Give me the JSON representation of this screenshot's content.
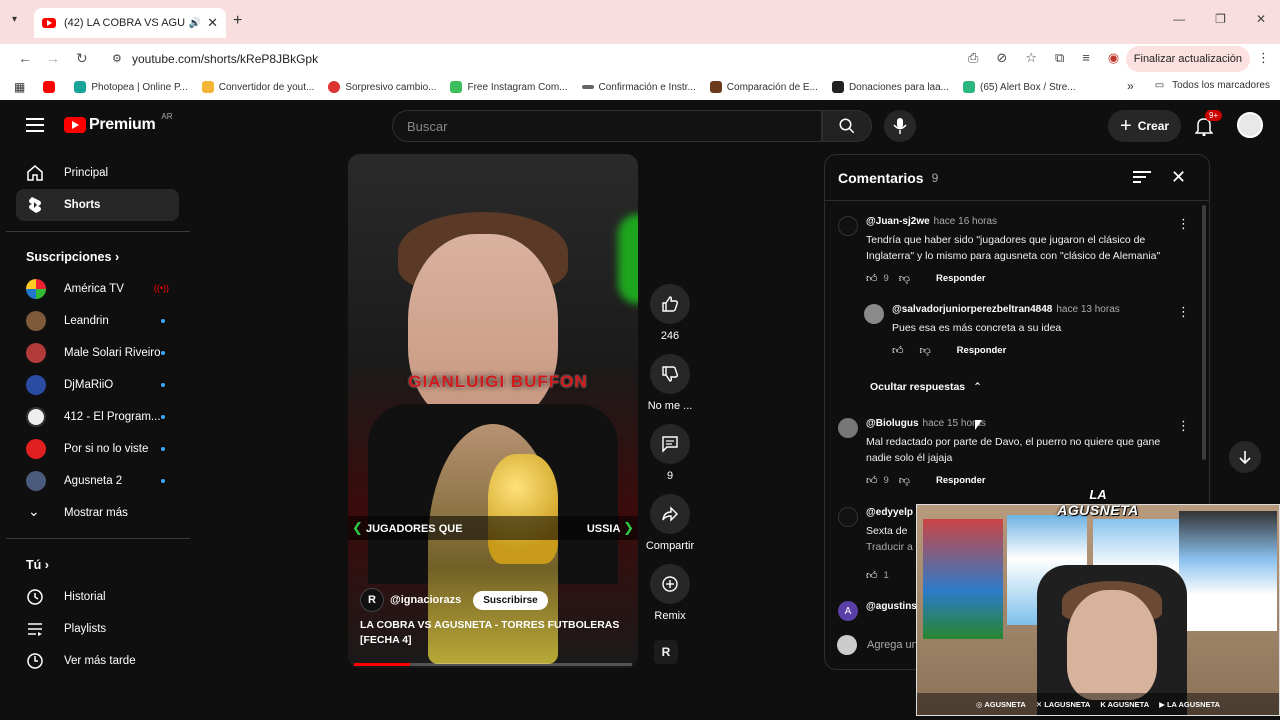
{
  "browser": {
    "tab_title": "(42) LA COBRA VS AGUSNE",
    "url": "youtube.com/shorts/kReP8JBkGpk",
    "update_label": "Finalizar actualización",
    "bookmarks": [
      {
        "label": "Photopea | Online P...",
        "color": "#18a497"
      },
      {
        "label": "Convertidor de yout...",
        "color": "#f2b534"
      },
      {
        "label": "Sorpresivo cambio...",
        "color": "#d33"
      },
      {
        "label": "Free Instagram Com...",
        "color": "#3cbf5a"
      },
      {
        "label": "Confirmación e Instr...",
        "color": "#666"
      },
      {
        "label": "Comparación de E...",
        "color": "#6b3a1a"
      },
      {
        "label": "Donaciones para laa...",
        "color": "#222"
      },
      {
        "label": "(65) Alert Box / Stre...",
        "color": "#2bb57f"
      }
    ],
    "all_bookmarks": "Todos los marcadores"
  },
  "header": {
    "logo_text": "Premium",
    "country": "AR",
    "search_placeholder": "Buscar",
    "create_label": "Crear",
    "notif_badge": "9+"
  },
  "sidebar": {
    "main": [
      {
        "label": "Principal",
        "icon": "home-icon"
      },
      {
        "label": "Shorts",
        "icon": "shorts-icon"
      }
    ],
    "subs_title": "Suscripciones",
    "subs": [
      {
        "label": "América TV",
        "color": "#e8e8e8",
        "live": true
      },
      {
        "label": "Leandrin",
        "color": "#7d5b3a"
      },
      {
        "label": "Male Solari Riveiro",
        "color": "#b23a3a"
      },
      {
        "label": "DjMaRiiO",
        "color": "#2a4da3"
      },
      {
        "label": "412 - El Program...",
        "color": "#eeeeee"
      },
      {
        "label": "Por si no lo viste",
        "color": "#e02020"
      },
      {
        "label": "Agusneta 2",
        "color": "#4a5a7a"
      }
    ],
    "show_more": "Mostrar más",
    "you_title": "Tú",
    "you": [
      {
        "label": "Historial",
        "icon": "history-icon"
      },
      {
        "label": "Playlists",
        "icon": "playlists-icon"
      },
      {
        "label": "Ver más tarde",
        "icon": "watch-later-icon"
      }
    ]
  },
  "short": {
    "overlay_name": "GIANLUIGI BUFFON",
    "banner_left": "JUGADORES QUE",
    "banner_right": "USSIA",
    "channel": "@ignaciorazs",
    "subscribe": "Suscribirse",
    "title": "LA COBRA VS AGUSNETA - TORRES FUTBOLERAS [FECHA 4]",
    "progress": 0.2
  },
  "actions": {
    "likes": "246",
    "dislike_label": "No me ...",
    "comments": "9",
    "share_label": "Compartir",
    "remix_label": "Remix"
  },
  "comments": {
    "title": "Comentarios",
    "count": "9",
    "reply_label": "Responder",
    "hide_replies": "Ocultar respuestas",
    "add_placeholder": "Agrega un",
    "items": [
      {
        "user": "@Juan-sj2we",
        "time": "hace 16 horas",
        "text1": "Tendría que haber sido \"jugadores que jugaron el clásico de",
        "text2": "Inglaterra\" y lo mismo para agusneta con \"clásico de Alemania\"",
        "likes": "9"
      },
      {
        "user": "@salvadorjuniorperezbeltran4848",
        "time": "hace 13 horas",
        "text1": "Pues esa es más concreta a su idea"
      },
      {
        "user": "@Biolugus",
        "time": "hace 15 horas",
        "text1": "Mal redactado por parte de Davo, el puerro no quiere que gane",
        "text2": "nadie solo él jajaja",
        "likes": "9"
      },
      {
        "user": "@edyyelp",
        "text1": "Sexta de",
        "text2": "Traducir a",
        "likes": "1"
      },
      {
        "user": "@agustins"
      }
    ]
  },
  "stream_overlay": {
    "logo_line1": "LA",
    "logo_line2": "AGUSNETA",
    "socials": [
      "AGUSNETA",
      "LAGUSNETA",
      "AGUSNETA",
      "LA AGUSNETA"
    ]
  }
}
